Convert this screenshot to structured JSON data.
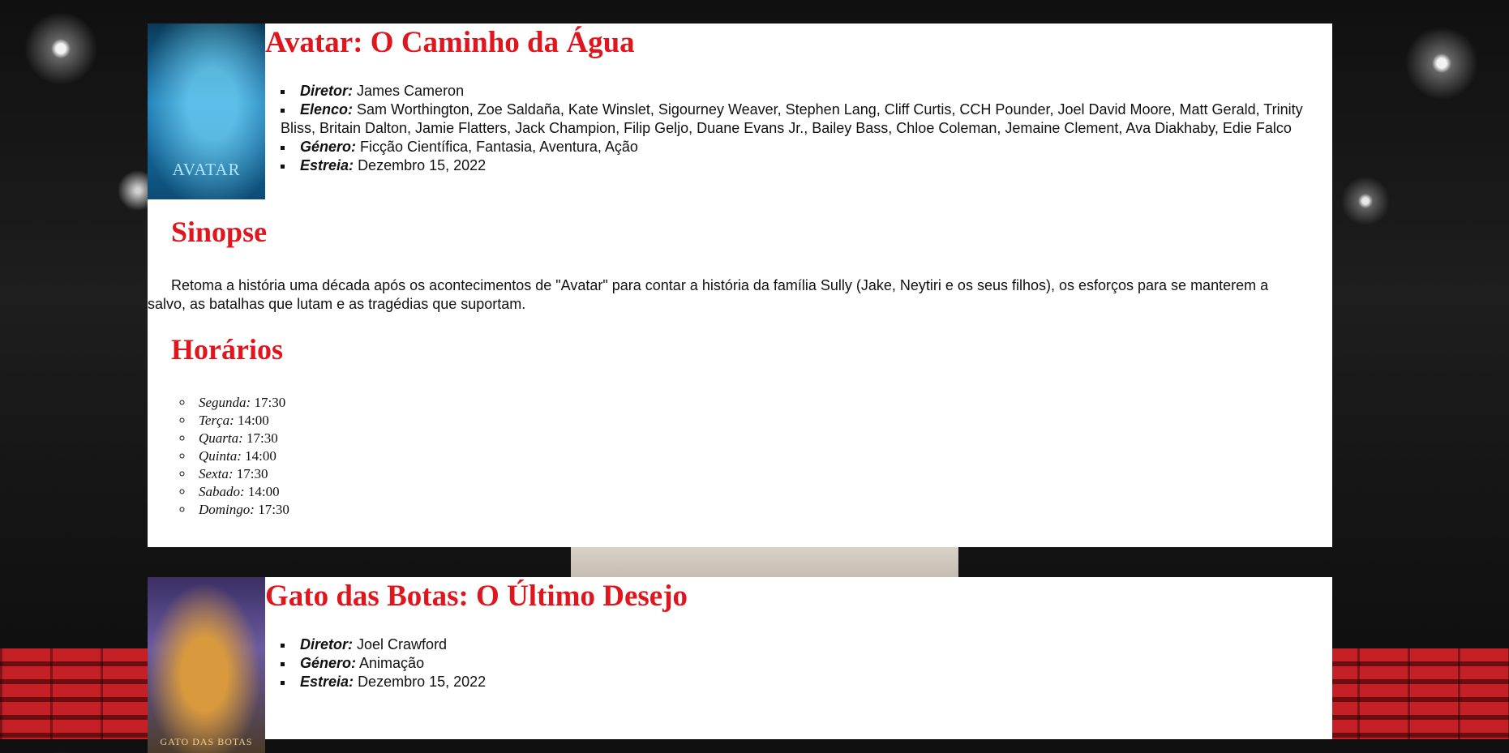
{
  "movies": [
    {
      "title": "Avatar: O Caminho da Água",
      "poster_text": "AVATAR",
      "info": [
        {
          "key": "Diretor:",
          "value": "James Cameron"
        },
        {
          "key": "Elenco:",
          "value": "Sam Worthington, Zoe Saldaña, Kate Winslet, Sigourney Weaver, Stephen Lang, Cliff Curtis, CCH Pounder, Joel David Moore, Matt Gerald, Trinity Bliss, Britain Dalton, Jamie Flatters, Jack Champion, Filip Geljo, Duane Evans Jr., Bailey Bass, Chloe Coleman, Jemaine Clement, Ava Diakhaby, Edie Falco"
        },
        {
          "key": "Género:",
          "value": "Ficção Científica, Fantasia, Aventura, Ação"
        },
        {
          "key": "Estreia:",
          "value": "Dezembro 15, 2022"
        }
      ],
      "synopsis_title": "Sinopse",
      "synopsis": "Retoma a história uma década após os acontecimentos de \"Avatar\" para contar a história da família Sully (Jake, Neytiri e os seus filhos), os esforços para se manterem a salvo, as batalhas que lutam e as tragédias que suportam.",
      "schedule_title": "Horários",
      "schedule": [
        {
          "day": "Segunda:",
          "time": "17:30"
        },
        {
          "day": "Terça:",
          "time": "14:00"
        },
        {
          "day": "Quarta:",
          "time": "17:30"
        },
        {
          "day": "Quinta:",
          "time": "14:00"
        },
        {
          "day": "Sexta:",
          "time": "17:30"
        },
        {
          "day": "Sabado:",
          "time": "14:00"
        },
        {
          "day": "Domingo:",
          "time": "17:30"
        }
      ]
    },
    {
      "title": "Gato das Botas: O Último Desejo",
      "poster_text": "GATO DAS BOTAS",
      "info": [
        {
          "key": "Diretor:",
          "value": "Joel Crawford"
        },
        {
          "key": "Género:",
          "value": "Animação"
        },
        {
          "key": "Estreia:",
          "value": "Dezembro 15, 2022"
        }
      ]
    }
  ]
}
